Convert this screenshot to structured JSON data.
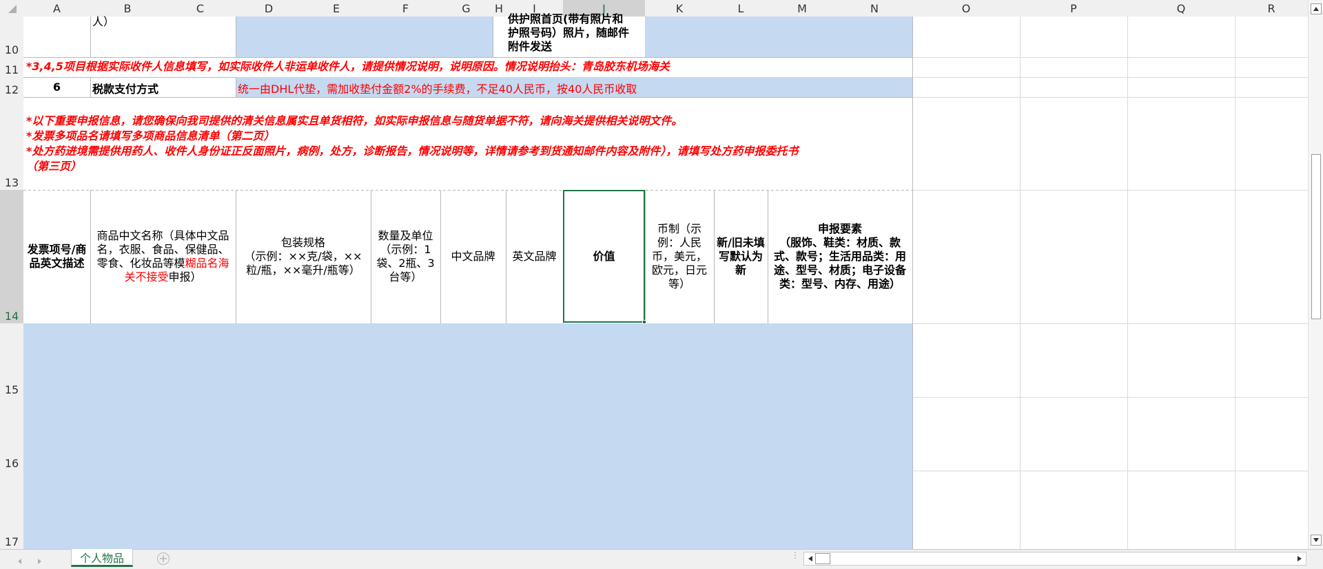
{
  "columns": [
    "A",
    "B",
    "C",
    "D",
    "E",
    "F",
    "G",
    "H",
    "I",
    "J",
    "K",
    "L",
    "M",
    "N",
    "O",
    "P",
    "Q",
    "R"
  ],
  "selected_column": "J",
  "rows": [
    "10",
    "11",
    "12",
    "13",
    "14",
    "15",
    "16",
    "17"
  ],
  "selected_row": "14",
  "row10": {
    "b_text": "人）",
    "i_lines": [
      "供护照首页(带有照片和",
      "护照号码）照片，随邮件",
      "附件发送"
    ]
  },
  "row11": {
    "note": "*3,4,5项目根据实际收件人信息填写，如实际收件人非运单收件人，请提供情况说明，说明原因。情况说明抬头：青岛胶东机场海关"
  },
  "row12": {
    "num": "6",
    "label": "税款支付方式",
    "value": "统一由DHL代垫，需加收垫付金额2%的手续费，不足40人民币，按40人民币收取"
  },
  "row13": {
    "lines": [
      "*以下重要申报信息，请您确保向我司提供的清关信息属实且单货相符，如实际申报信息与随货单据不符，请向海关提供相关说明文件。",
      "*发票多项品名请填写多项商品信息清单（第二页）",
      "*处方药进境需提供用药人、收件人身份证正反面照片，病例，处方，诊断报告，情况说明等，详情请参考到货通知邮件内容及附件），请填写处方药申报委托书",
      "（第三页）"
    ]
  },
  "row14": {
    "a": "发票项号/商品英文描述",
    "b_black": "商品中文名称（具体中文品名，衣服、食品、保健品、零食、化妆品等模",
    "b_red": "糊品名海关不接受",
    "b_tail": "申报）",
    "d_line1": "包装规格",
    "d_line2": "（示例：××克/袋，××粒/瓶，××毫升/瓶等）",
    "f": "数量及单位（示例：1袋、2瓶、3台等）",
    "g": "中文品牌",
    "h": "英文品牌",
    "j": "价值",
    "k": "币制（示例：人民币，美元，欧元，日元等）",
    "l": "新/旧未填写默认为新",
    "m_line1": "申报要素",
    "m_rest": "（服饰、鞋类：材质、款式、款号；生活用品类：用途、型号、材质；电子设备类：型号、内存、用途）"
  },
  "sheet_tab": "个人物品",
  "colors": {
    "fill": "#c5d9f1",
    "accent": "#217346",
    "note_red": "#ff0000"
  }
}
